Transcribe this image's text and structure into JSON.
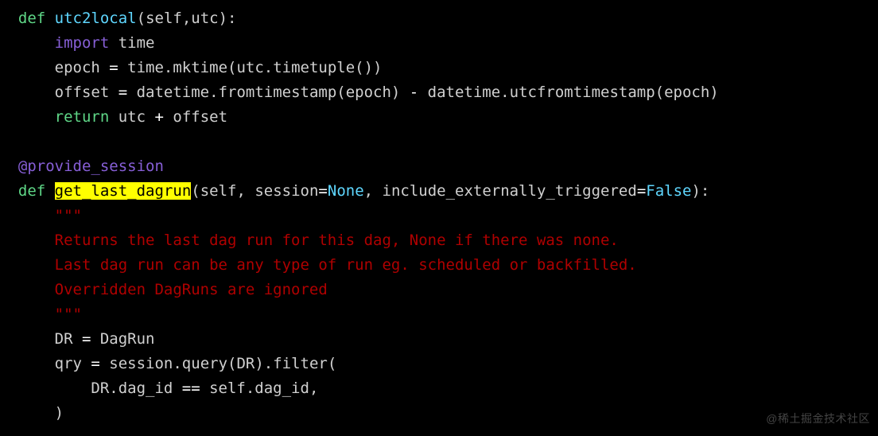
{
  "code": {
    "l1": {
      "def": "def",
      "fn": "utc2local",
      "sig": "(self,utc):"
    },
    "l2": {
      "import": "import",
      "mod": "time"
    },
    "l3": {
      "a": "epoch ",
      "eq": "=",
      "b": " time.mktime(utc.timetuple())"
    },
    "l4": {
      "a": "offset ",
      "eq": "=",
      "b": " datetime.fromtimestamp(epoch) ",
      "minus": "-",
      "c": " datetime.utcfromtimestamp(epoch)"
    },
    "l5": {
      "ret": "return",
      "a": " utc ",
      "plus": "+",
      "b": " offset"
    },
    "l6": {
      "dec": "@provide_session"
    },
    "l7": {
      "def": "def",
      "fn": "get_last_dagrun",
      "a": "(self, session",
      "eq1": "=",
      "none": "None",
      "b": ", include_externally_triggered",
      "eq2": "=",
      "false": "False",
      "c": "):"
    },
    "l8": {
      "q": "\"\"\""
    },
    "l9": {
      "t": "Returns the last dag run for this dag, None if there was none."
    },
    "l10": {
      "t": "Last dag run can be any type of run eg. scheduled or backfilled."
    },
    "l11": {
      "t": "Overridden DagRuns are ignored"
    },
    "l12": {
      "q": "\"\"\""
    },
    "l13": {
      "a": "DR ",
      "eq": "=",
      "b": " DagRun"
    },
    "l14": {
      "a": "qry ",
      "eq": "=",
      "b": " session.query(DR).filter("
    },
    "l15": {
      "a": "DR.dag_id ",
      "eq": "==",
      "b": " self.dag_id,"
    },
    "l16": {
      "a": ")"
    }
  },
  "watermark": "@稀土掘金技术社区"
}
